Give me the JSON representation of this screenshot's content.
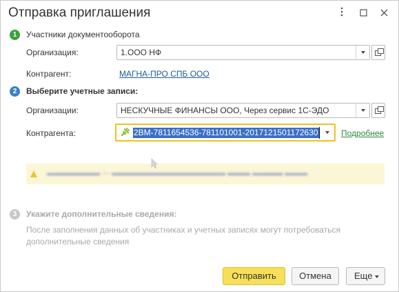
{
  "window": {
    "title": "Отправка приглашения",
    "more_icon": "more-vertical-icon",
    "maximize_icon": "maximize-icon",
    "close_icon": "close-icon"
  },
  "steps": [
    {
      "number": "1",
      "title": "Участники документооборота",
      "color": "#3aa33a"
    },
    {
      "number": "2",
      "title": "Выберите учетные записи:",
      "color": "#3c7fc8"
    },
    {
      "number": "3",
      "title": "Укажите дополнительные сведения:",
      "color": "#c7c7c7"
    }
  ],
  "participants": {
    "org_label": "Организация:",
    "org_value": "1.ООО НФ",
    "counterparty_label": "Контрагент:",
    "counterparty_value": "МАГНА-ПРО СПБ ООО"
  },
  "accounts": {
    "orgs_label": "Организации:",
    "orgs_value": "НЕСКУЧНЫЕ ФИНАНСЫ ООО, Через сервис 1С-ЭДО",
    "counterparty_label": "Контрагента:",
    "counterparty_value": "2BM-7811654536-781101001-2017121501172630",
    "details_link": "Подробнее"
  },
  "additional": {
    "hint": "После заполнения данных об участниках и учетных записях могут потребоваться дополнительные сведения"
  },
  "buttons": {
    "send": "Отправить",
    "cancel": "Отмена",
    "more": "Еще"
  },
  "colors": {
    "accent_yellow": "#f0c21a",
    "selection_blue": "#3b6fc8",
    "link_blue": "#1c5aa0",
    "link_green": "#2a8a3a"
  }
}
